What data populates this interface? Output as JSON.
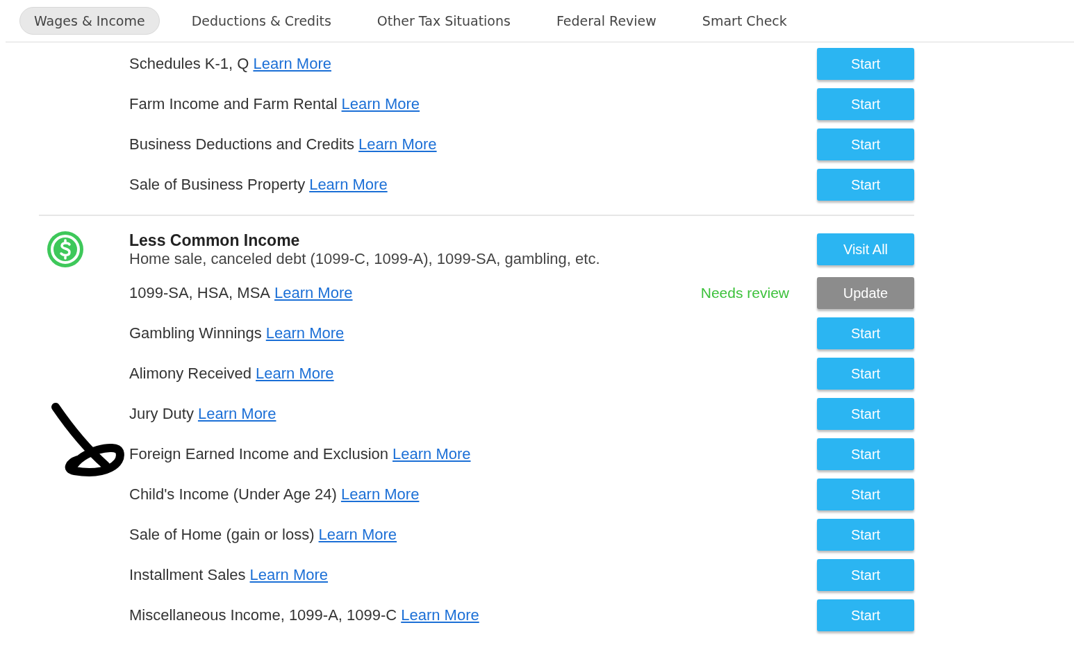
{
  "tabs": [
    {
      "label": "Wages & Income",
      "selected": true
    },
    {
      "label": "Deductions & Credits",
      "selected": false
    },
    {
      "label": "Other Tax Situations",
      "selected": false
    },
    {
      "label": "Federal Review",
      "selected": false
    },
    {
      "label": "Smart Check",
      "selected": false
    }
  ],
  "sections": [
    {
      "items": [
        {
          "label": "Schedules K-1, Q",
          "link": "Learn More",
          "button": {
            "label": "Start",
            "kind": "primary"
          }
        },
        {
          "label": "Farm Income and Farm Rental",
          "link": "Learn More",
          "button": {
            "label": "Start",
            "kind": "primary"
          }
        },
        {
          "label": "Business Deductions and Credits",
          "link": "Learn More",
          "button": {
            "label": "Start",
            "kind": "primary"
          }
        },
        {
          "label": "Sale of Business Property",
          "link": "Learn More",
          "button": {
            "label": "Start",
            "kind": "primary"
          }
        }
      ]
    },
    {
      "title": "Less Common Income",
      "subtitle": "Home sale, canceled debt (1099-C, 1099-A), 1099-SA, gambling, etc.",
      "button": {
        "label": "Visit All",
        "kind": "primary"
      },
      "items": [
        {
          "label": "1099-SA, HSA, MSA",
          "link": "Learn More",
          "status": "Needs review",
          "button": {
            "label": "Update",
            "kind": "secondary"
          }
        },
        {
          "label": "Gambling Winnings",
          "link": "Learn More",
          "button": {
            "label": "Start",
            "kind": "primary"
          }
        },
        {
          "label": "Alimony Received",
          "link": "Learn More",
          "button": {
            "label": "Start",
            "kind": "primary"
          }
        },
        {
          "label": "Jury Duty",
          "link": "Learn More",
          "button": {
            "label": "Start",
            "kind": "primary"
          }
        },
        {
          "label": "Foreign Earned Income and Exclusion",
          "link": "Learn More",
          "button": {
            "label": "Start",
            "kind": "primary"
          }
        },
        {
          "label": "Child's Income (Under Age 24)",
          "link": "Learn More",
          "button": {
            "label": "Start",
            "kind": "primary"
          }
        },
        {
          "label": "Sale of Home (gain or loss)",
          "link": "Learn More",
          "button": {
            "label": "Start",
            "kind": "primary"
          }
        },
        {
          "label": "Installment Sales",
          "link": "Learn More",
          "button": {
            "label": "Start",
            "kind": "primary"
          }
        },
        {
          "label": "Miscellaneous Income, 1099-A, 1099-C",
          "link": "Learn More",
          "button": {
            "label": "Start",
            "kind": "primary"
          }
        }
      ]
    }
  ]
}
